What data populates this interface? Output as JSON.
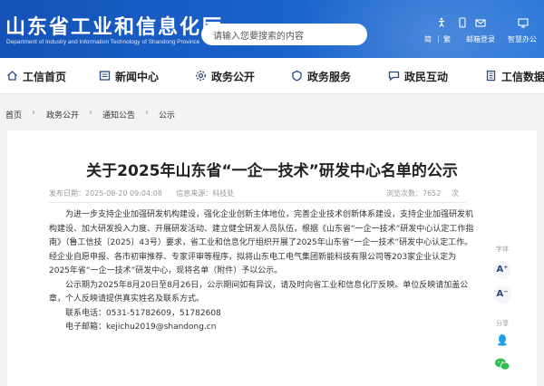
{
  "header": {
    "site_title": "山东省工业和信息化厅",
    "site_subtitle": "Department of Industry and Information Technology of Shandong Province",
    "search_placeholder": "请输入您要搜索的内容",
    "tools": {
      "simplified": "简",
      "traditional": "繁",
      "mail_login": "邮箱登录",
      "smart_q": "智慧办公"
    },
    "colors": {
      "header_bg": "#1b63cc"
    }
  },
  "nav": {
    "items": [
      {
        "label": "工信首页",
        "icon": "home-icon"
      },
      {
        "label": "新闻中心",
        "icon": "news-icon"
      },
      {
        "label": "政务公开",
        "icon": "gear-icon"
      },
      {
        "label": "政务服务",
        "icon": "shield-icon"
      },
      {
        "label": "政民互动",
        "icon": "chat-icon"
      },
      {
        "label": "工信数据",
        "icon": "data-icon"
      }
    ]
  },
  "breadcrumb": [
    "首页",
    "政务公开",
    "通知公告",
    "公示"
  ],
  "article": {
    "title": "关于2025年山东省“一企一技术”研发中心名单的公示",
    "publish_label": "发布日期：",
    "publish_date": "2025-08-20 09:04:08",
    "source_label": "信息来源：",
    "source": "科技处",
    "views_label": "浏览次数：",
    "views": "7652",
    "views_unit": "次",
    "paragraphs": [
      "为进一步支持企业加强研发机构建设，强化企业创新主体地位，完善企业技术创新体系建设，支持企业加强研发机构建设、加大研发投入力度、开展研发活动、建立健全研发人员队伍，根据《山东省“一企一技术”研发中心认定工作指南》（鲁工信技〔2025〕43号）要求，省工业和信息化厅组织开展了2025年山东省“一企一技术”研发中心认定工作。经企业自愿申报、各市初审推荐、专家评审等程序，拟将山东电工电气集团新能科技有限公司等203家企业认定为2025年省“一企一技术”研发中心，现将名单（附件）予以公示。",
      "公示期为2025年8月20日至8月26日，公示期间如有异议，请及时向省工业和信息化厅反映。单位反映请加盖公章，个人反映请提供真实姓名及联系方式。"
    ],
    "contact_phone": "联系电话：0531-51782609，51782608",
    "contact_email": "电子邮箱：kejichu2019@shandong.cn"
  },
  "side": {
    "font_label": "字体",
    "font_up": "A⁺",
    "font_down": "A⁻",
    "share_label": "分享"
  }
}
